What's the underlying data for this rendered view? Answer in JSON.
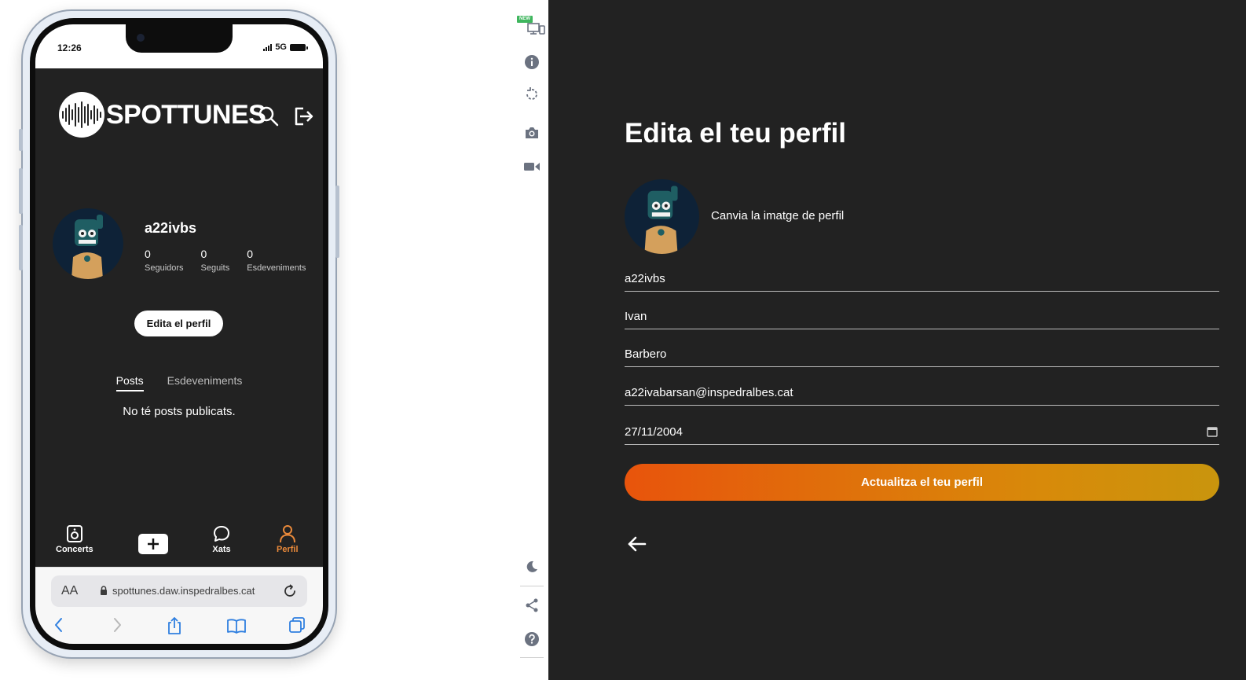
{
  "phone": {
    "status": {
      "time": "12:26",
      "network": "5G"
    },
    "logo_text": "SPOTTUNES",
    "profile": {
      "username": "a22ivbs",
      "stats": [
        {
          "value": "0",
          "label": "Seguidors"
        },
        {
          "value": "0",
          "label": "Seguits"
        },
        {
          "value": "0",
          "label": "Esdeveniments"
        }
      ],
      "edit_button": "Edita el perfil"
    },
    "tabs": {
      "posts": "Posts",
      "events": "Esdeveniments"
    },
    "empty_message": "No té posts publicats.",
    "bottom_nav": {
      "concerts": "Concerts",
      "chats": "Xats",
      "profile": "Perfil"
    },
    "safari": {
      "aa": "AA",
      "url": "spottunes.daw.inspedralbes.cat"
    }
  },
  "toolbar": {
    "new_badge": "NEW",
    "icons": [
      "responsive-icon",
      "info-icon",
      "rotate-icon",
      "camera-icon",
      "video-icon",
      "moon-icon",
      "share-icon",
      "help-icon"
    ]
  },
  "edit_form": {
    "title": "Edita el teu perfil",
    "change_picture": "Canvia la imatge de perfil",
    "username": "a22ivbs",
    "first_name": "Ivan",
    "last_name": "Barbero",
    "email": "a22ivabarsan@inspedralbes.cat",
    "birthdate": "27/11/2004",
    "submit": "Actualitza el teu perfil"
  },
  "colors": {
    "background_dark": "#222222",
    "accent_orange": "#e9893a",
    "button_gradient_start": "#e8540c",
    "button_gradient_end": "#c9950d"
  }
}
